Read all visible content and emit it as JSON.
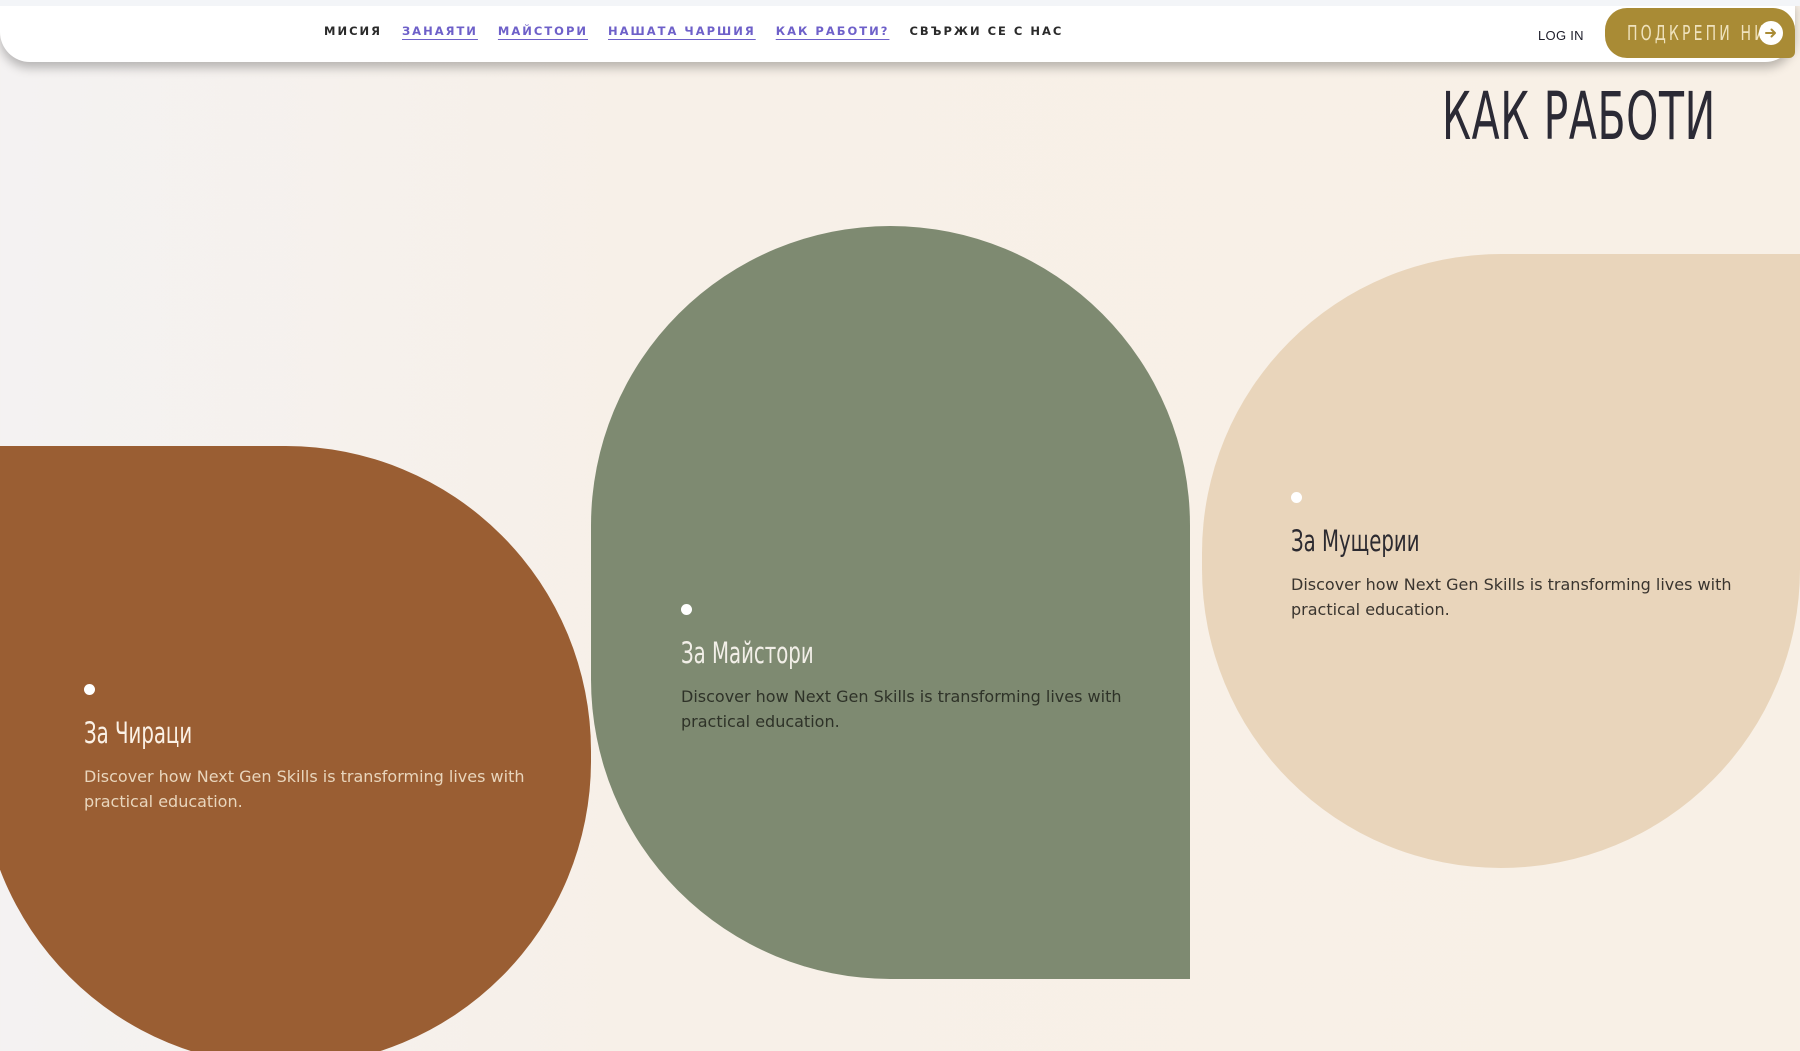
{
  "header": {
    "nav": [
      {
        "label": "МИСИЯ",
        "style": "plain"
      },
      {
        "label": "ЗАНАЯТИ",
        "style": "link"
      },
      {
        "label": "МАЙСТОРИ",
        "style": "link"
      },
      {
        "label": "НАШАТА ЧАРШИЯ",
        "style": "link"
      },
      {
        "label": "КАК РАБОТИ?",
        "style": "link"
      },
      {
        "label": "СВЪРЖИ СЕ С НАС",
        "style": "plain"
      }
    ],
    "login_label": "LOG IN",
    "support_label": "ПОДКРЕПИ НИ",
    "support_icon": "arrow-right-icon"
  },
  "main": {
    "title": "КАК РАБОТИ",
    "cards": [
      {
        "title": "За Чираци",
        "text": "Discover how Next Gen Skills is transforming lives with practical education.",
        "color": "#9a5e33"
      },
      {
        "title": "За Майстори",
        "text": "Discover how Next Gen Skills is transforming lives with practical education.",
        "color": "#7e8a71"
      },
      {
        "title": "За Мущерии",
        "text": "Discover how Next Gen Skills is transforming lives with practical education.",
        "color": "#e9d5bb"
      }
    ]
  },
  "colors": {
    "accent_gold": "#a98b35",
    "link_purple": "#6e60c9",
    "text_dark": "#2b2a35"
  }
}
